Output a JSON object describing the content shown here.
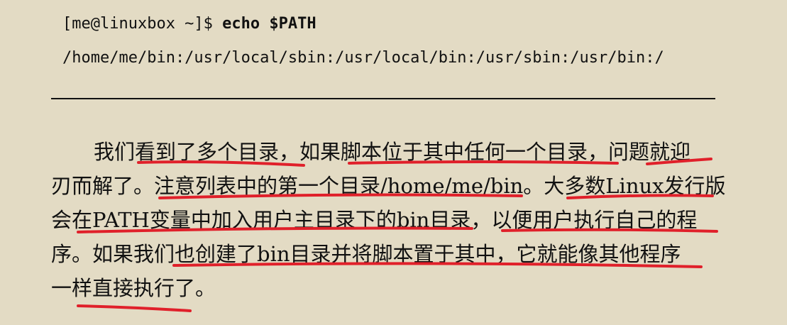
{
  "terminal": {
    "prompt": "[me@linuxbox ~]$ ",
    "command": "echo $PATH",
    "output": "/home/me/bin:/usr/local/sbin:/usr/local/bin:/usr/sbin:/usr/bin:/"
  },
  "paragraph": {
    "lines": [
      "我们看到了多个目录，如果脚本位于其中任何一个目录，问题就迎",
      "刃而解了。注意列表中的第一个目录/home/me/bin。大多数Linux发行版",
      "会在PATH变量中加入用户主目录下的bin目录，以便用户执行自己的程",
      "序。如果我们也创建了bin目录并将脚本置于其中，它就能像其他程序",
      "一样直接执行了。"
    ]
  },
  "colors": {
    "background": "#e3dbc4",
    "annotation": "#e0202a"
  }
}
